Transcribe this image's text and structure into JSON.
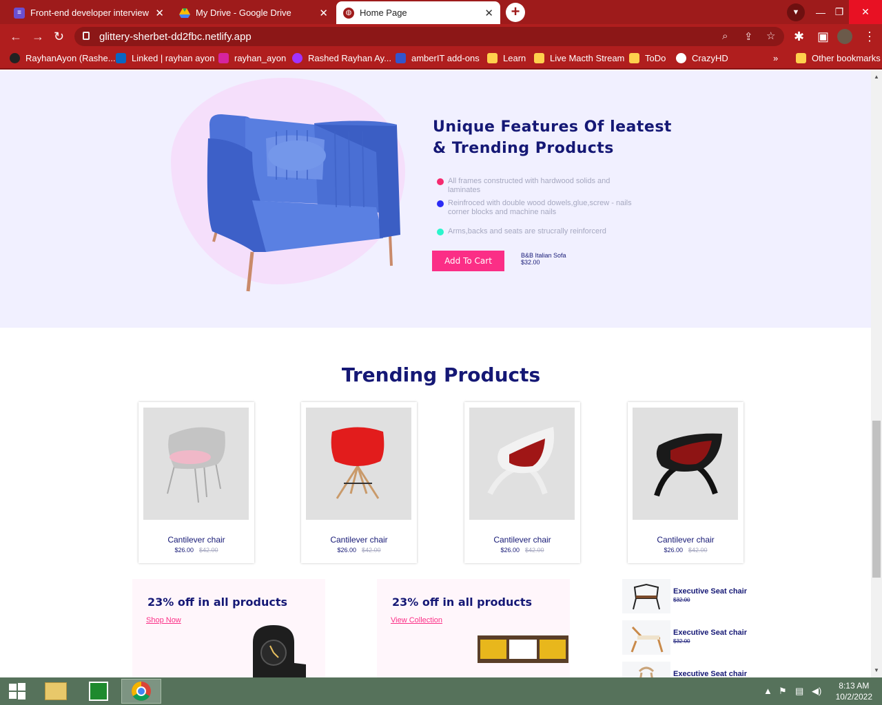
{
  "browser": {
    "tabs": [
      {
        "title": "Front-end developer interview as",
        "active": false
      },
      {
        "title": "My Drive - Google Drive",
        "active": false
      },
      {
        "title": "Home Page",
        "active": true
      }
    ],
    "new_tab_label": "+",
    "url": "glittery-sherbet-dd2fbc.netlify.app",
    "bookmarks": [
      {
        "label": "RayhanAyon (Rashe...",
        "icon": "github-icon"
      },
      {
        "label": "Linked | rayhan ayon",
        "icon": "linkedin-icon"
      },
      {
        "label": "rayhan_ayon",
        "icon": "instagram-icon"
      },
      {
        "label": "Rashed Rayhan Ay...",
        "icon": "messenger-icon"
      },
      {
        "label": "amberIT add-ons",
        "icon": "amberit-icon"
      },
      {
        "label": "Learn",
        "icon": "folder-icon"
      },
      {
        "label": "Live Macth Stream",
        "icon": "folder-icon"
      },
      {
        "label": "ToDo",
        "icon": "folder-icon"
      },
      {
        "label": "CrazyHD",
        "icon": "globe-icon"
      }
    ],
    "more_bookmarks": "»",
    "other_bookmarks": "Other bookmarks"
  },
  "hero": {
    "title": "Unique Features Of leatest & Trending Products",
    "features": [
      {
        "text": "All frames constructed with hardwood solids and laminates",
        "color": "#f52b70"
      },
      {
        "text": "Reinfroced with double wood dowels,glue,screw - nails corner blocks and machine nails",
        "color": "#2b2bf5"
      },
      {
        "text": "Arms,backs and seats are strucrally reinforcerd",
        "color": "#2bf5cc"
      }
    ],
    "cart_button": "Add To Cart",
    "product_name": "B&B Italian Sofa",
    "product_price": "$32.00"
  },
  "trending": {
    "title": "Trending Products",
    "products": [
      {
        "name": "Cantilever chair",
        "price": "$26.00",
        "old_price": "$42.00"
      },
      {
        "name": "Cantilever chair",
        "price": "$26.00",
        "old_price": "$42.00"
      },
      {
        "name": "Cantilever chair",
        "price": "$26.00",
        "old_price": "$42.00"
      },
      {
        "name": "Cantilever chair",
        "price": "$26.00",
        "old_price": "$42.00"
      }
    ]
  },
  "promos": [
    {
      "title": "23% off in all products",
      "link": "Shop Now"
    },
    {
      "title": "23% off in all products",
      "link": "View Collection"
    }
  ],
  "executive": [
    {
      "name": "Executive Seat chair",
      "price": "$32.00"
    },
    {
      "name": "Executive Seat chair",
      "price": "$32.00"
    },
    {
      "name": "Executive Seat chair",
      "price": ""
    }
  ],
  "taskbar": {
    "time": "8:13 AM",
    "date": "10/2/2022"
  }
}
